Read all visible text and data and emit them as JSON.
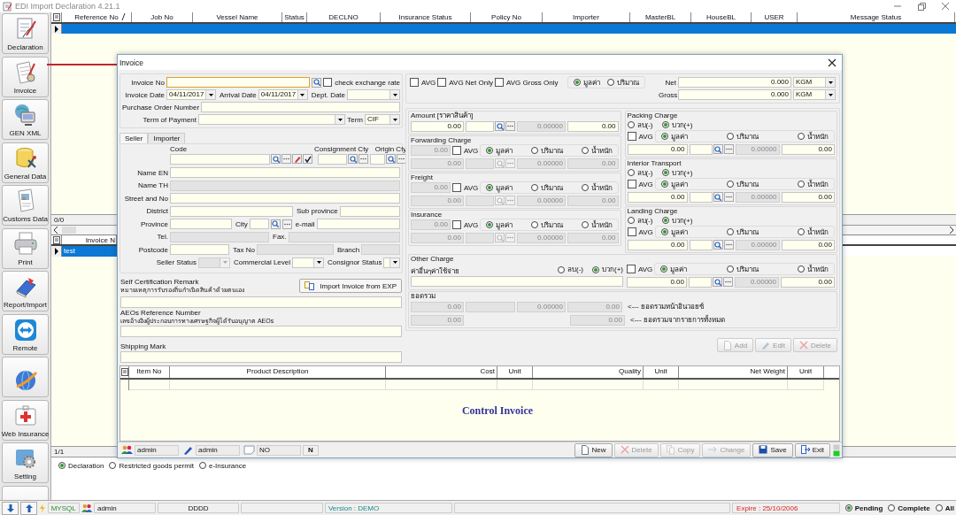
{
  "app": {
    "title": "EDI Import Declaration 4.21.1"
  },
  "sidebar": [
    {
      "label": "Declaration",
      "kind": "pen"
    },
    {
      "label": "Invoice",
      "kind": "invoice"
    },
    {
      "label": "GEN XML",
      "kind": "xml"
    },
    {
      "label": "General Data",
      "kind": "database"
    },
    {
      "label": "Customs Data",
      "kind": "document"
    },
    {
      "label": "Print",
      "kind": "printer"
    },
    {
      "label": "Report/Import",
      "kind": "book"
    },
    {
      "label": "Remote",
      "kind": "remote"
    },
    {
      "kind": "globe"
    },
    {
      "label": "Web Insurance",
      "kind": "web"
    },
    {
      "label": "Setting",
      "kind": "gear"
    },
    {
      "kind": "globe"
    }
  ],
  "main_grid": {
    "columns": [
      {
        "label": "Reference No",
        "sorted": true
      },
      {
        "label": "Job No",
        "sorted": false
      },
      {
        "label": "Vessel Name",
        "sorted": false
      },
      {
        "label": "Status",
        "sorted": false
      },
      {
        "label": "DECLNO",
        "sorted": false
      },
      {
        "label": "Insurance Status",
        "sorted": false
      },
      {
        "label": "Policy No",
        "sorted": false
      },
      {
        "label": "Importer",
        "sorted": false
      },
      {
        "label": "MasterBL",
        "sorted": false
      },
      {
        "label": "HouseBL",
        "sorted": false
      },
      {
        "label": "USER",
        "sorted": false
      },
      {
        "label": "Message Status",
        "sorted": false
      }
    ],
    "rows": [
      {
        "selected": true
      }
    ]
  },
  "lower_grid": {
    "counter": "0/0",
    "columns": [
      "Invoice N"
    ],
    "rows": [
      {
        "cells": [
          "test"
        ],
        "selected": true
      }
    ],
    "footer_counter": "1/1"
  },
  "mode_options": [
    {
      "label": "Declaration",
      "selected": true
    },
    {
      "label": "Restricted goods permit",
      "selected": false
    },
    {
      "label": "e-Insurance",
      "selected": false
    }
  ],
  "status_bar": {
    "db": "MYSQL",
    "user": "admin",
    "code": "DDDD",
    "version": "Version : DEMO",
    "expire": "Expire : 25/10/2006",
    "filters": [
      {
        "label": "Pending",
        "selected": true
      },
      {
        "label": "Complete",
        "selected": false
      },
      {
        "label": "All",
        "selected": false
      }
    ]
  },
  "dialog": {
    "title": "Invoice",
    "invoice_no": {
      "label": "Invoice No",
      "focused": true
    },
    "check_exchange_rate": {
      "label": "check exchange rate",
      "checked": false
    },
    "dates": [
      {
        "label": "Invoice Date",
        "value": "04/11/2017"
      },
      {
        "label": "Arrival Date",
        "value": "04/11/2017"
      },
      {
        "label": "Dept. Date"
      }
    ],
    "purchase_order": {
      "label": "Purchase Order Number"
    },
    "term_of_payment": {
      "label": "Term of Payment"
    },
    "term": {
      "label": "Term",
      "value": "CIF"
    },
    "avg_options": [
      {
        "label": "AVG",
        "checked": false
      },
      {
        "label": "AVG Net Only",
        "checked": false
      },
      {
        "label": "AVG Gross Only",
        "checked": false
      }
    ],
    "basis": [
      {
        "label": "มูลค่า",
        "selected": true
      },
      {
        "label": "ปริมาณ",
        "selected": false
      }
    ],
    "weights": [
      {
        "label": "Net",
        "value": "0.000",
        "unit": "KGM"
      },
      {
        "label": "Gross",
        "value": "0.000",
        "unit": "KGM"
      }
    ],
    "party_tabs": [
      {
        "label": "Seller",
        "selected": true
      },
      {
        "label": "Importer",
        "selected": false
      }
    ],
    "party_head": [
      {
        "label": "Code",
        "kind": "code"
      },
      {
        "label": "Consignment Cty",
        "kind": "lookup"
      },
      {
        "label": "Origin Cty",
        "kind": "lookup"
      }
    ],
    "party_rows": [
      [
        {
          "label": "Name EN",
          "kind": "text",
          "disabled": false
        }
      ],
      [
        {
          "label": "Name TH",
          "kind": "text",
          "disabled": true
        }
      ],
      [
        {
          "label": "Street and No",
          "kind": "text",
          "disabled": false
        }
      ],
      [
        {
          "label": "District",
          "kind": "text",
          "disabled": false
        },
        {
          "label": "Sub province",
          "kind": "text",
          "disabled": false
        }
      ],
      [
        {
          "label": "Province",
          "kind": "text",
          "disabled": false
        },
        {
          "label": "City",
          "kind": "lookup",
          "disabled": false
        },
        {
          "label": "e-mail",
          "kind": "text",
          "disabled": false
        }
      ],
      [
        {
          "label": "Tel.",
          "kind": "text",
          "disabled": true
        },
        {
          "label": "Fax.",
          "kind": "text",
          "disabled": true
        }
      ],
      [
        {
          "label": "Postcode",
          "kind": "text",
          "disabled": false
        },
        {
          "label": "Tax No",
          "kind": "text",
          "disabled": true
        },
        {
          "label": "Branch",
          "kind": "text",
          "disabled": true
        }
      ],
      [
        {
          "label": "Seller Status",
          "kind": "combo",
          "disabled": true
        },
        {
          "label": "Commercial Level",
          "kind": "combo",
          "disabled": false
        },
        {
          "label": "Consignor Status",
          "kind": "combo",
          "disabled": false
        }
      ]
    ],
    "self_cert": {
      "label": "Self Certification Remark",
      "label_th": "หมายเหตุการรับรองถิ่นกำเนิดสินค้าด้วยตนเอง"
    },
    "import_button": "Import Invoice from EXP",
    "aeo": {
      "label": "AEOs Reference Number",
      "label_th": "เลขอ้างอิงผู้ประกอบการทางเศรษฐกิจผู้ได้รับอนุญาต AEOs"
    },
    "shipping_mark": {
      "label": "Shipping Mark"
    },
    "amount": {
      "title": "Amount [ราคาสินค้า]",
      "amount": "0.00",
      "rate": "0.00000",
      "converted": "0.00",
      "disabled": false
    },
    "left_charges": [
      {
        "title": "Forwarding Charge",
        "base": "0.00",
        "avg": {
          "label": "AVG",
          "checked": false
        },
        "basis": [
          {
            "label": "มูลค่า",
            "selected": true
          },
          {
            "label": "ปริมาณ",
            "selected": false
          },
          {
            "label": "น้ำหนัก",
            "selected": false
          }
        ],
        "amount": "0.00",
        "rate": "0.00000",
        "converted": "0.00",
        "disabled": true
      },
      {
        "title": "Freight",
        "base": "0.00",
        "avg": {
          "label": "AVG",
          "checked": false
        },
        "basis": [
          {
            "label": "มูลค่า",
            "selected": true
          },
          {
            "label": "ปริมาณ",
            "selected": false
          },
          {
            "label": "น้ำหนัก",
            "selected": false
          }
        ],
        "amount": "0.00",
        "rate": "0.00000",
        "converted": "0.00",
        "disabled": true
      },
      {
        "title": "Insurance",
        "base": "0.00",
        "avg": {
          "label": "AVG",
          "checked": false
        },
        "basis": [
          {
            "label": "มูลค่า",
            "selected": true
          },
          {
            "label": "ปริมาณ",
            "selected": false
          },
          {
            "label": "น้ำหนัก",
            "selected": false
          }
        ],
        "amount": "0.00",
        "rate": "0.00000",
        "converted": "0.00",
        "disabled": true
      }
    ],
    "right_charges": [
      {
        "title": "Packing Charge",
        "sign": [
          {
            "label": "ลบ(-)",
            "selected": false
          },
          {
            "label": "บวก(+)",
            "selected": true
          }
        ],
        "avg": {
          "label": "AVG",
          "checked": false
        },
        "basis": [
          {
            "label": "มูลค่า",
            "selected": true
          },
          {
            "label": "ปริมาณ",
            "selected": false
          },
          {
            "label": "น้ำหนัก",
            "selected": false
          }
        ],
        "amount": "0.00",
        "rate": "0.00000",
        "converted": "0.00",
        "disabled": false
      },
      {
        "title": "Interior Transport",
        "sign": [
          {
            "label": "ลบ(-)",
            "selected": false
          },
          {
            "label": "บวก(+)",
            "selected": true
          }
        ],
        "avg": {
          "label": "AVG",
          "checked": false
        },
        "basis": [
          {
            "label": "มูลค่า",
            "selected": true
          },
          {
            "label": "ปริมาณ",
            "selected": false
          },
          {
            "label": "น้ำหนัก",
            "selected": false
          }
        ],
        "amount": "0.00",
        "rate": "0.00000",
        "converted": "0.00",
        "disabled": false
      },
      {
        "title": "Landing Charge",
        "sign": [
          {
            "label": "ลบ(-)",
            "selected": false
          },
          {
            "label": "บวก(+)",
            "selected": true
          }
        ],
        "avg": {
          "label": "AVG",
          "checked": false
        },
        "basis": [
          {
            "label": "มูลค่า",
            "selected": true
          },
          {
            "label": "ปริมาณ",
            "selected": false
          },
          {
            "label": "น้ำหนัก",
            "selected": false
          }
        ],
        "amount": "0.00",
        "rate": "0.00000",
        "converted": "0.00",
        "disabled": false
      }
    ],
    "other_charge": {
      "title": "Other Charge",
      "label": "ค่าอื่นๆค่าใช้จ่าย",
      "sign": [
        {
          "label": "ลบ(-)",
          "selected": false
        },
        {
          "label": "บวก(+)",
          "selected": true
        }
      ],
      "avg": {
        "label": "AVG",
        "checked": false
      },
      "basis": [
        {
          "label": "มูลค่า",
          "selected": true
        },
        {
          "label": "ปริมาณ",
          "selected": false
        },
        {
          "label": "น้ำหนัก",
          "selected": false
        }
      ],
      "amount": "0.00",
      "rate": "0.00000",
      "converted": "0.00",
      "disabled": false
    },
    "totals": {
      "title": "ยอดรวม",
      "rows": [
        {
          "amount": "0.00",
          "rate": "0.00000",
          "converted": "0.00",
          "note": "<--- ยอดรวมหน้าอินวอยซ์"
        },
        {
          "amount": "0.00",
          "converted": "0.00",
          "note": "<--- ยอดรวมจากรายการทั้งหมด"
        }
      ]
    },
    "item_actions": [
      {
        "label": "Add",
        "kind": "add",
        "disabled": true
      },
      {
        "label": "Edit",
        "kind": "edit",
        "disabled": true
      },
      {
        "label": "Delete",
        "kind": "delete",
        "disabled": true
      }
    ],
    "items": {
      "columns": [
        "Item No",
        "Product Description",
        "Cost",
        "Unit",
        "Quality",
        "Unit",
        "Net Weight",
        "Unit"
      ],
      "caption": "Control Invoice"
    },
    "footer": {
      "fields": [
        {
          "kind": "users",
          "value": "admin"
        },
        {
          "kind": "pen",
          "value": "admin"
        },
        {
          "kind": "note",
          "value": "NO"
        }
      ],
      "flag": "N",
      "actions": [
        {
          "label": "New",
          "kind": "new",
          "disabled": false
        },
        {
          "label": "Delete",
          "kind": "delete",
          "disabled": true
        },
        {
          "label": "Copy",
          "kind": "copy",
          "disabled": true
        },
        {
          "label": "Change",
          "kind": "change",
          "disabled": true
        },
        {
          "label": "Save",
          "kind": "save",
          "disabled": false
        },
        {
          "label": "Exit",
          "kind": "exit",
          "disabled": false
        }
      ]
    }
  }
}
